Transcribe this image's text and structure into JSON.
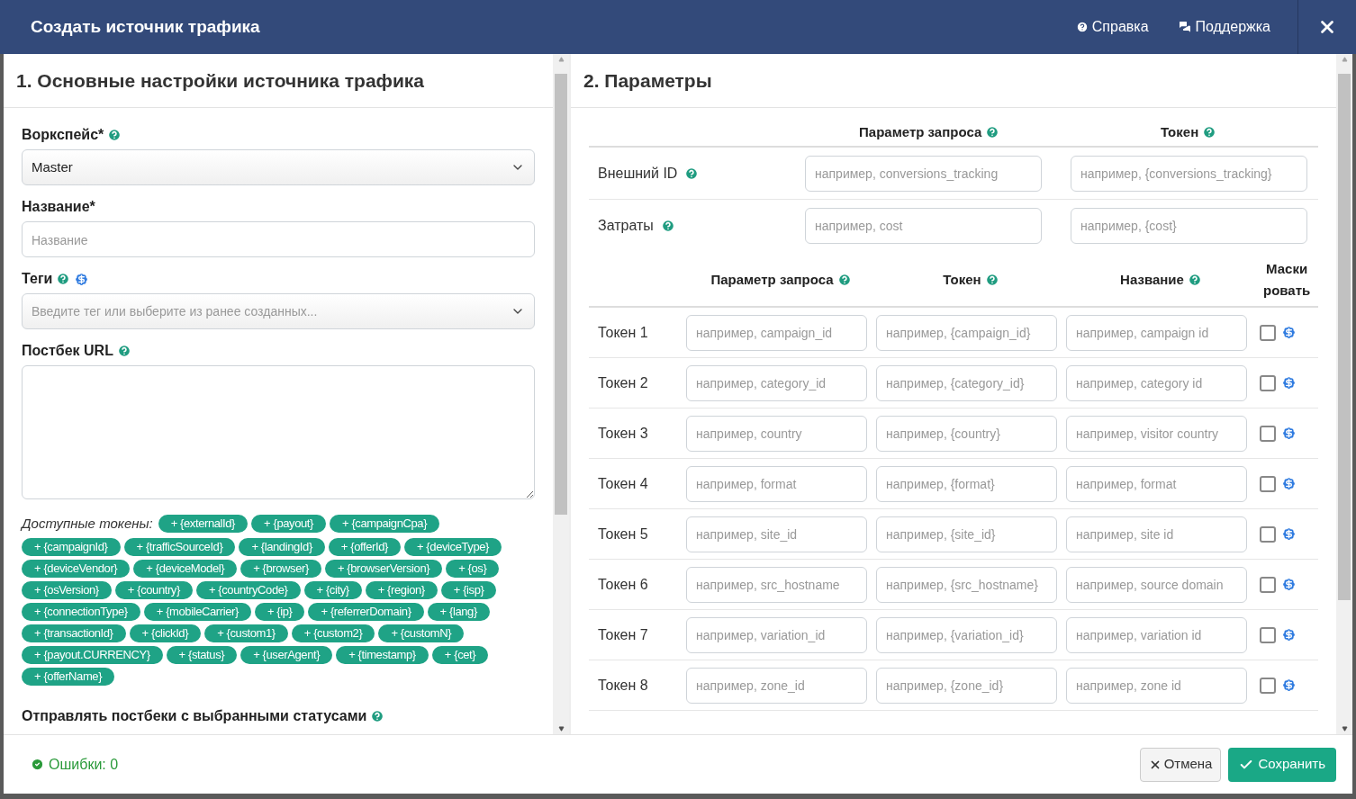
{
  "header": {
    "title": "Создать источник трафика",
    "links": [
      {
        "kind": "help",
        "label": "Справка"
      },
      {
        "kind": "chat",
        "label": "Поддержка"
      }
    ]
  },
  "left": {
    "title": "1. Основные настройки источника трафика",
    "fields": [
      {
        "kind": "select",
        "label": "Воркспейс*",
        "icons": [
          {
            "kind": "help"
          }
        ],
        "value": "Master"
      },
      {
        "kind": "input",
        "label": "Название*",
        "placeholder": "Название"
      },
      {
        "kind": "select",
        "label": "Теги",
        "icons": [
          {
            "kind": "help"
          },
          {
            "kind": "paid"
          }
        ],
        "placeholder": "Введите тег или выберите из ранее созданных..."
      },
      {
        "kind": "textarea",
        "label": "Постбек URL",
        "icons": [
          {
            "kind": "help"
          }
        ]
      }
    ],
    "tokens_label": "Доступные токены:",
    "tokens": [
      "+ {externalId}",
      "+ {payout}",
      "+ {campaignCpa}",
      "+ {campaignId}",
      "+ {trafficSourceId}",
      "+ {landingId}",
      "+ {offerId}",
      "+ {deviceType}",
      "+ {deviceVendor}",
      "+ {deviceModel}",
      "+ {browser}",
      "+ {browserVersion}",
      "+ {os}",
      "+ {osVersion}",
      "+ {country}",
      "+ {countryCode}",
      "+ {city}",
      "+ {region}",
      "+ {isp}",
      "+ {connectionType}",
      "+ {mobileCarrier}",
      "+ {ip}",
      "+ {referrerDomain}",
      "+ {lang}",
      "+ {transactionId}",
      "+ {clickId}",
      "+ {custom1}",
      "+ {custom2}",
      "+ {customN}",
      "+ {payout.CURRENCY}",
      "+ {status}",
      "+ {userAgent}",
      "+ {timestamp}",
      "+ {cet}",
      "+ {offerName}"
    ],
    "next_label": "Отправлять постбеки с выбранными статусами"
  },
  "right": {
    "title": "2. Параметры",
    "top_columns": [
      "Параметр запроса",
      "Токен"
    ],
    "top_rows": [
      {
        "label": "Внешний ID",
        "param_placeholder": "например, conversions_tracking",
        "token_placeholder": "например, {conversions_tracking}"
      },
      {
        "label": "Затраты",
        "param_placeholder": "например, cost",
        "token_placeholder": "например, {cost}"
      }
    ],
    "token_columns": [
      "Параметр запроса",
      "Токен",
      "Название"
    ],
    "mask_header": [
      "Маски",
      "ровать"
    ],
    "token_rows": [
      {
        "label": "Токен 1",
        "param_placeholder": "например, campaign_id",
        "token_placeholder": "например, {campaign_id}",
        "name_placeholder": "например, campaign id",
        "masked": false
      },
      {
        "label": "Токен 2",
        "param_placeholder": "например, category_id",
        "token_placeholder": "например, {category_id}",
        "name_placeholder": "например, category id",
        "masked": false
      },
      {
        "label": "Токен 3",
        "param_placeholder": "например, country",
        "token_placeholder": "например, {country}",
        "name_placeholder": "например, visitor country",
        "masked": false
      },
      {
        "label": "Токен 4",
        "param_placeholder": "например, format",
        "token_placeholder": "например, {format}",
        "name_placeholder": "например, format",
        "masked": false
      },
      {
        "label": "Токен 5",
        "param_placeholder": "например, site_id",
        "token_placeholder": "например, {site_id}",
        "name_placeholder": "например, site id",
        "masked": false
      },
      {
        "label": "Токен 6",
        "param_placeholder": "например, src_hostname",
        "token_placeholder": "например, {src_hostname}",
        "name_placeholder": "например, source domain",
        "masked": false
      },
      {
        "label": "Токен 7",
        "param_placeholder": "например, variation_id",
        "token_placeholder": "например, {variation_id}",
        "name_placeholder": "например, variation id",
        "masked": false
      },
      {
        "label": "Токен 8",
        "param_placeholder": "например, zone_id",
        "token_placeholder": "например, {zone_id}",
        "name_placeholder": "например, zone id",
        "masked": false
      }
    ]
  },
  "footer": {
    "status": "Ошибки: 0",
    "buttons": [
      {
        "kind": "cancel",
        "label": "Отмена"
      },
      {
        "kind": "save",
        "label": "Сохранить"
      }
    ]
  }
}
